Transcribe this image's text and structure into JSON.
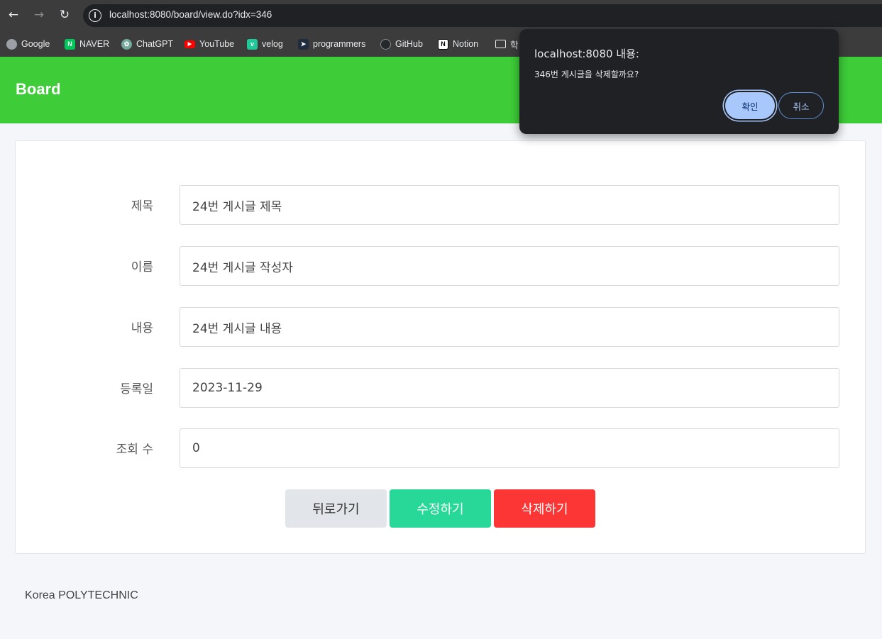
{
  "browser": {
    "url": "localhost:8080/board/view.do?idx=346",
    "bookmarks": [
      {
        "label": "Google",
        "icon": "globe-icon",
        "color": "#9aa0a6"
      },
      {
        "label": "NAVER",
        "icon": "naver-icon",
        "color": "#03c75a"
      },
      {
        "label": "ChatGPT",
        "icon": "chatgpt-icon",
        "color": "#74aa9c"
      },
      {
        "label": "YouTube",
        "icon": "youtube-icon",
        "color": "#ff0000"
      },
      {
        "label": "velog",
        "icon": "velog-icon",
        "color": "#20c997"
      },
      {
        "label": "programmers",
        "icon": "programmers-icon",
        "color": "#202b3d"
      },
      {
        "label": "GitHub",
        "icon": "github-icon",
        "color": "#24292e"
      },
      {
        "label": "Notion",
        "icon": "notion-icon",
        "color": "#ffffff"
      },
      {
        "label": "학",
        "icon": "folder-icon",
        "color": "#e8eaed"
      }
    ]
  },
  "header": {
    "brand": "Board",
    "color": "#3ecd38"
  },
  "form": {
    "fields": [
      {
        "label": "제목",
        "value": "24번 게시글 제목"
      },
      {
        "label": "이름",
        "value": "24번 게시글 작성자"
      },
      {
        "label": "내용",
        "value": "24번 게시글 내용"
      },
      {
        "label": "등록일",
        "value": "2023-11-29"
      },
      {
        "label": "조회 수",
        "value": "0"
      }
    ],
    "buttons": {
      "back": "뒤로가기",
      "edit": "수정하기",
      "delete": "삭제하기"
    }
  },
  "footer": {
    "text": "Korea POLYTECHNIC"
  },
  "dialog": {
    "title": "localhost:8080 내용:",
    "message": "346번 게시글을 삭제할까요?",
    "ok": "확인",
    "cancel": "취소"
  }
}
